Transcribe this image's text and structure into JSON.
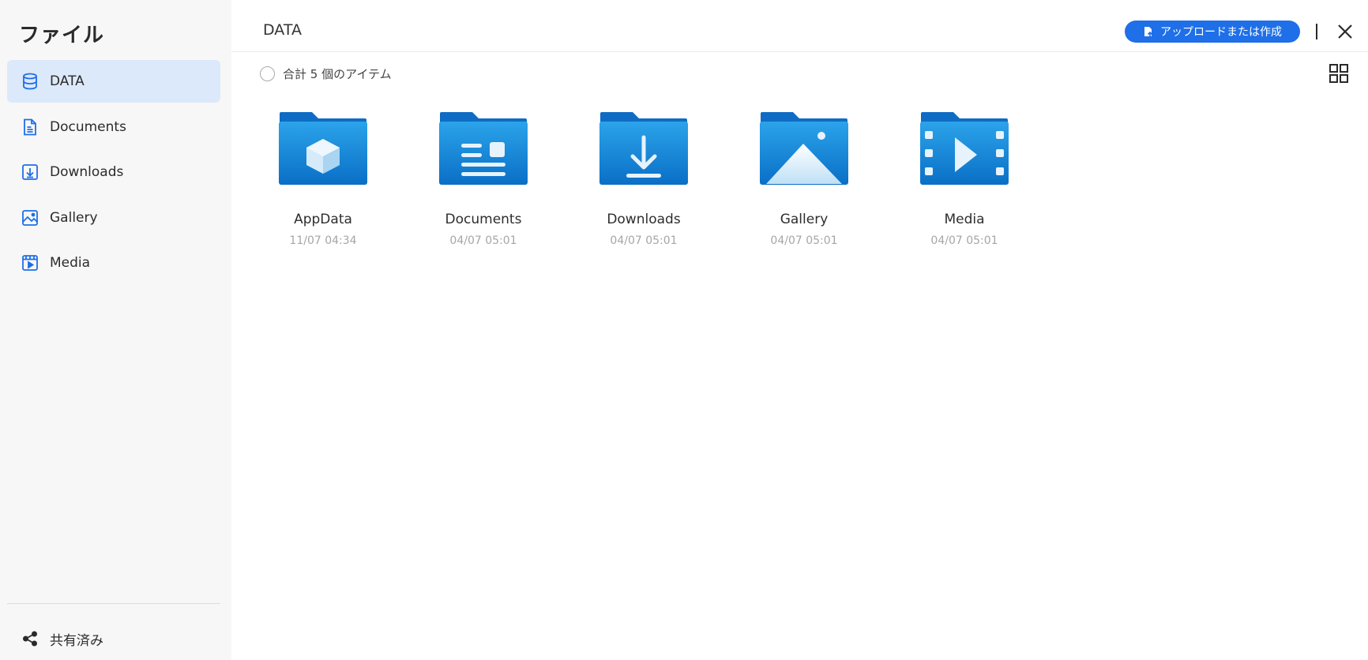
{
  "sidebar": {
    "title": "ファイル",
    "items": [
      {
        "label": "DATA",
        "icon": "database-icon",
        "active": true
      },
      {
        "label": "Documents",
        "icon": "document-icon"
      },
      {
        "label": "Downloads",
        "icon": "download-icon"
      },
      {
        "label": "Gallery",
        "icon": "gallery-icon"
      },
      {
        "label": "Media",
        "icon": "media-icon"
      }
    ],
    "shared_label": "共有済み"
  },
  "header": {
    "title": "DATA",
    "upload_label": "アップロードまたは作成"
  },
  "toolbar": {
    "item_count": "合計 5 個のアイテム"
  },
  "folders": [
    {
      "name": "AppData",
      "date": "11/07 04:34",
      "icon": "appdata-folder-icon"
    },
    {
      "name": "Documents",
      "date": "04/07 05:01",
      "icon": "documents-folder-icon"
    },
    {
      "name": "Downloads",
      "date": "04/07 05:01",
      "icon": "downloads-folder-icon"
    },
    {
      "name": "Gallery",
      "date": "04/07 05:01",
      "icon": "gallery-folder-icon"
    },
    {
      "name": "Media",
      "date": "04/07 05:01",
      "icon": "media-folder-icon"
    }
  ],
  "colors": {
    "accent": "#1e6fe8",
    "active_nav_bg": "#dce9fa",
    "folder_blue": "#1a8ad8"
  }
}
